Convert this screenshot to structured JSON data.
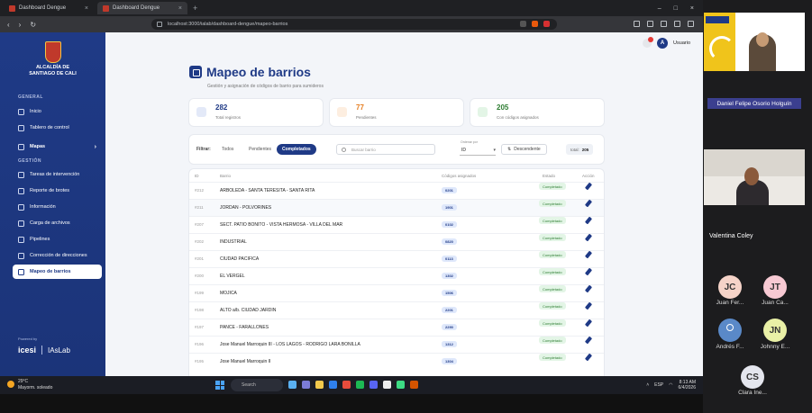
{
  "browser": {
    "tabs": [
      {
        "label": "Dashboard Dengue",
        "active": false
      },
      {
        "label": "Dashboard Dengue",
        "active": true
      }
    ],
    "url": "localhost:3000/ialab/dashboard-dengue/mapeo-barrios"
  },
  "sidebar": {
    "org_line1": "ALCALDÍA DE",
    "org_line2": "SANTIAGO DE CALI",
    "section_general": "GENERAL",
    "section_gestion": "GESTIÓN",
    "items": [
      {
        "label": "Inicio"
      },
      {
        "label": "Tablero de control"
      },
      {
        "label": "Mapas"
      },
      {
        "label": "Tareas de intervención"
      },
      {
        "label": "Reporte de brotes"
      },
      {
        "label": "Información"
      },
      {
        "label": "Carga de archivos"
      },
      {
        "label": "Pipelines"
      },
      {
        "label": "Corrección de direcciones"
      },
      {
        "label": "Mapeo de barrios"
      }
    ],
    "powered": "Powered by",
    "brand1": "icesi",
    "brand2": "IAsLab"
  },
  "header": {
    "user": "Usuario",
    "notif_count": "9"
  },
  "page": {
    "title": "Mapeo de barrios",
    "subtitle": "Gestión y asignación de códigos de barrio para sumideros"
  },
  "stats": [
    {
      "value": "282",
      "label": "Total registros",
      "color": "#1f3a86"
    },
    {
      "value": "77",
      "label": "Pendientes",
      "color": "#e67e22"
    },
    {
      "value": "205",
      "label": "Con códigos asignados",
      "color": "#2e7d32"
    }
  ],
  "filters": {
    "label": "Filtrar:",
    "chips": [
      "Todos",
      "Pendientes",
      "Completados"
    ],
    "active_chip": "Completados",
    "search_placeholder": "Buscar barrio",
    "order_label": "Ordenar por",
    "order_value": "ID",
    "sort_label": "Descendente",
    "total_label": "total:",
    "total_value": "205"
  },
  "table": {
    "headers": [
      "ID",
      "Barrio",
      "Códigos asignados",
      "Estado",
      "Acción"
    ],
    "rows": [
      {
        "id": "#212",
        "barrio": "ARBOLEDA - SANTA TERESITA - SANTA RITA",
        "codes": [
          "0202",
          "0203",
          "0201"
        ],
        "status": "Completado"
      },
      {
        "id": "#211",
        "barrio": "JORDAN - POLVORINES",
        "codes": [
          "1914",
          "1901"
        ],
        "status": "Completado"
      },
      {
        "id": "#207",
        "barrio": "SECT. PATIO BONITO - VISTA HERMOSA - VILLA DEL MAR",
        "codes": [
          "0106",
          "0102"
        ],
        "status": "Completado"
      },
      {
        "id": "#202",
        "barrio": "INDUSTRIAL",
        "codes": [
          "0820"
        ],
        "status": "Completado"
      },
      {
        "id": "#201",
        "barrio": "CIUDAD PACIFICA",
        "codes": [
          "0113"
        ],
        "status": "Completado"
      },
      {
        "id": "#200",
        "barrio": "EL VERGEL",
        "codes": [
          "1302"
        ],
        "status": "Completado"
      },
      {
        "id": "#199",
        "barrio": "MOJICA",
        "codes": [
          "1506"
        ],
        "status": "Completado"
      },
      {
        "id": "#198",
        "barrio": "ALTO a/b. CIUDAD JARDIN",
        "codes": [
          "2201"
        ],
        "status": "Completado"
      },
      {
        "id": "#197",
        "barrio": "PANCE - FARALLONES",
        "codes": [
          "2290"
        ],
        "status": "Completado"
      },
      {
        "id": "#196",
        "barrio": "Jose Manuel Marroquin III - LOS LAGOS - RODRIGO LARA BONILLA",
        "codes": [
          "1304",
          "1306",
          "1312"
        ],
        "status": "Completado"
      },
      {
        "id": "#195",
        "barrio": "Jose Manuel Marroquin II",
        "codes": [
          "1304"
        ],
        "status": "Completado"
      }
    ]
  },
  "taskbar": {
    "temp": "29°C",
    "weather": "Mayorm. soleado",
    "search": "Search",
    "lang": "ESP",
    "time": "8:13 AM",
    "date": "6/4/2026"
  },
  "meeting": {
    "presenter_name": "Daniel Felipe Osorio Holguín",
    "speaker2_name": "Valentina Coley",
    "participants": [
      {
        "initials": "JC",
        "name": "Juan Fer...",
        "color": "#f5d3c8"
      },
      {
        "initials": "JT",
        "name": "Juan Ca...",
        "color": "#f7c9d3"
      },
      {
        "initials": "",
        "name": "Andrés F...",
        "color": "#5a89c8"
      },
      {
        "initials": "JN",
        "name": "Johnny E...",
        "color": "#e9f0a6"
      },
      {
        "initials": "CS",
        "name": "Clara Ine...",
        "color": "#e4e6ee"
      }
    ]
  }
}
